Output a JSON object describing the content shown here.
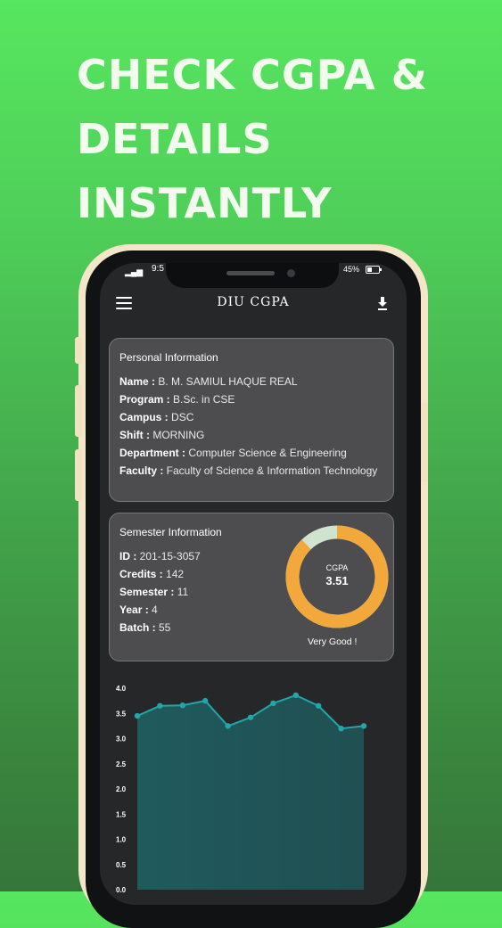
{
  "headline": {
    "line1": "CHECK CGPA &",
    "line2": "DETAILS",
    "line3": "INSTANTLY"
  },
  "status_bar": {
    "signal": "▂▄▆",
    "time": "9:5",
    "battery": "45%"
  },
  "app_bar": {
    "title": "DIU CGPA",
    "menu_icon": "hamburger-menu-icon",
    "download_icon": "download-icon"
  },
  "personal": {
    "title": "Personal Information",
    "fields": [
      {
        "label": "Name :",
        "value": " B. M. SAMIUL HAQUE REAL"
      },
      {
        "label": "Program :",
        "value": " B.Sc. in CSE"
      },
      {
        "label": "Campus :",
        "value": " DSC"
      },
      {
        "label": "Shift :",
        "value": " MORNING"
      },
      {
        "label": "Department :",
        "value": " Computer Science & Engineering"
      },
      {
        "label": "Faculty :",
        "value": " Faculty of Science & Information Technology"
      }
    ]
  },
  "semester": {
    "title": "Semester Information",
    "fields": [
      {
        "label": "ID :",
        "value": " 201-15-3057"
      },
      {
        "label": "Credits :",
        "value": " 142"
      },
      {
        "label": "Semester :",
        "value": " 11"
      },
      {
        "label": "Year :",
        "value": " 4"
      },
      {
        "label": "Batch :",
        "value": " 55"
      }
    ],
    "cgpa_label": "CGPA",
    "cgpa_value": "3.51",
    "cgpa_max": 4.0,
    "verdict": "Very Good !",
    "ring_color": "#f3a83b",
    "ring_rest_color": "#cfe3cf"
  },
  "chart_data": {
    "type": "area",
    "title": "",
    "xlabel": "",
    "ylabel": "",
    "ylim": [
      0,
      4.0
    ],
    "yticks": [
      "4.0",
      "3.5",
      "3.0",
      "2.5",
      "2.0",
      "1.5",
      "1.0",
      "0.5",
      "0.0"
    ],
    "series": [
      {
        "values": [
          3.45,
          3.65,
          3.66,
          3.75,
          3.25,
          3.42,
          3.7,
          3.86,
          3.65,
          3.2,
          3.25
        ]
      }
    ],
    "line_color": "#23a6a8",
    "fill_color": "#1f5d60",
    "grid": false
  }
}
